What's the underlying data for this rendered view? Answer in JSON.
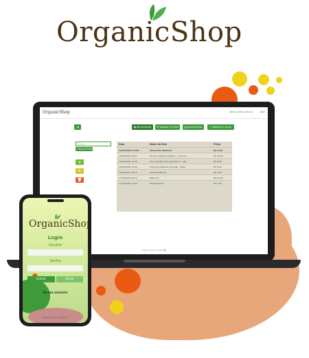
{
  "brand": {
    "name": "OrganicShop"
  },
  "colors": {
    "brand_brown": "#4a3416",
    "green": "#3e9a3a",
    "orange": "#e95a12",
    "yellow": "#f0d21b",
    "peach": "#e8a77a"
  },
  "desktop": {
    "app_title": "OrganicShop",
    "user_label": "Bem-vindo Arthurs",
    "logout_label": "Sair",
    "back_icon": "arrow-left-icon",
    "nav": [
      {
        "label": "Alimentação",
        "icon": "store-icon"
      },
      {
        "label": "Saladas e Frutas",
        "icon": "leaf-icon"
      },
      {
        "label": "Suplementos",
        "icon": "bottle-icon"
      },
      {
        "label": "Bebidas e sucos",
        "icon": "cup-icon"
      }
    ],
    "search_placeholder": "Buscar",
    "search_button": "Buscar itens",
    "actions": {
      "add": "+",
      "edit": "✎",
      "delete": "🗑"
    },
    "table": {
      "headers": [
        "Data",
        "Nome do item",
        "Preço"
      ],
      "rows": [
        [
          "14/04/2024 12:00",
          "Alimentos Naturais",
          "R$ 0,00"
        ],
        [
          "15/04/2024 10:21",
          "Kit Suco Natural Orgânico – 6 sucos",
          "R$ 39,00"
        ],
        [
          "16/04/2024 13:48",
          "Pool Laranjas Sem Agrotóxico – 1kg",
          "R$ 8,00"
        ],
        [
          "16/04/2024 15:34",
          "Cenoura Orgânica Unidade – 500g",
          "R$ 6,00"
        ],
        [
          "16/04/2024 16:10",
          "Abacate Natural",
          "R$ 4,00"
        ],
        [
          "17/04/2024 09:15",
          "Melancia",
          "R$ 10,00"
        ],
        [
          "17/04/2024 11:02",
          "Banana Prata",
          "R$ 5,00"
        ]
      ]
    },
    "footer": "Organic Shop ® 2024 🌿"
  },
  "mobile": {
    "title": "OrganicShop",
    "heading": "Login",
    "user_label": "Usuário",
    "password_label": "Senha",
    "login_button": "Entrar",
    "back_button": "Voltar",
    "name_label": "Nome usuário",
    "footer": "Organic Shop ® 2024 🌿"
  }
}
